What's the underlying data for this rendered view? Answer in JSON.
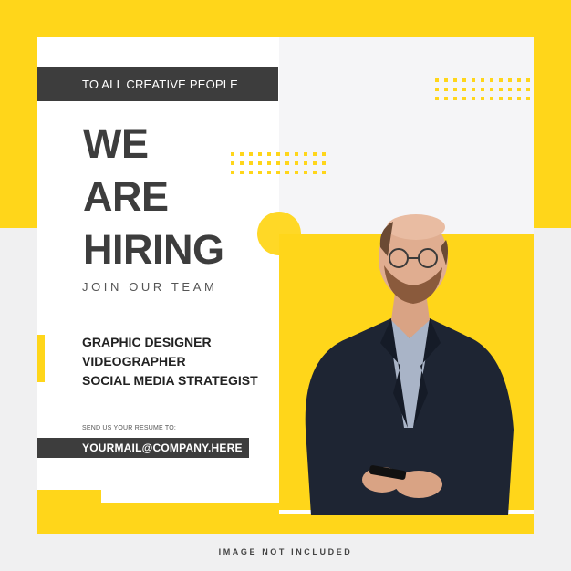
{
  "poster": {
    "tagline": "TO ALL CREATIVE PEOPLE",
    "headline": [
      "WE",
      "ARE",
      "HIRING"
    ],
    "subheadline": "JOIN OUR TEAM",
    "roles": [
      "GRAPHIC DESIGNER",
      "VIDEOGRAPHER",
      "SOCIAL MEDIA STRATEGIST"
    ],
    "resume_label": "SEND US YOUR RESUME TO:",
    "email": "YOURMAIL@COMPANY.HERE"
  },
  "footer_note": "IMAGE NOT INCLUDED",
  "colors": {
    "accent": "#ffd61a",
    "dark": "#3d3d3d",
    "suit": "#1e2533",
    "shirt": "#a9b4c7"
  },
  "photo": {
    "subject": "man-in-suit-with-glasses-holding-phone"
  }
}
